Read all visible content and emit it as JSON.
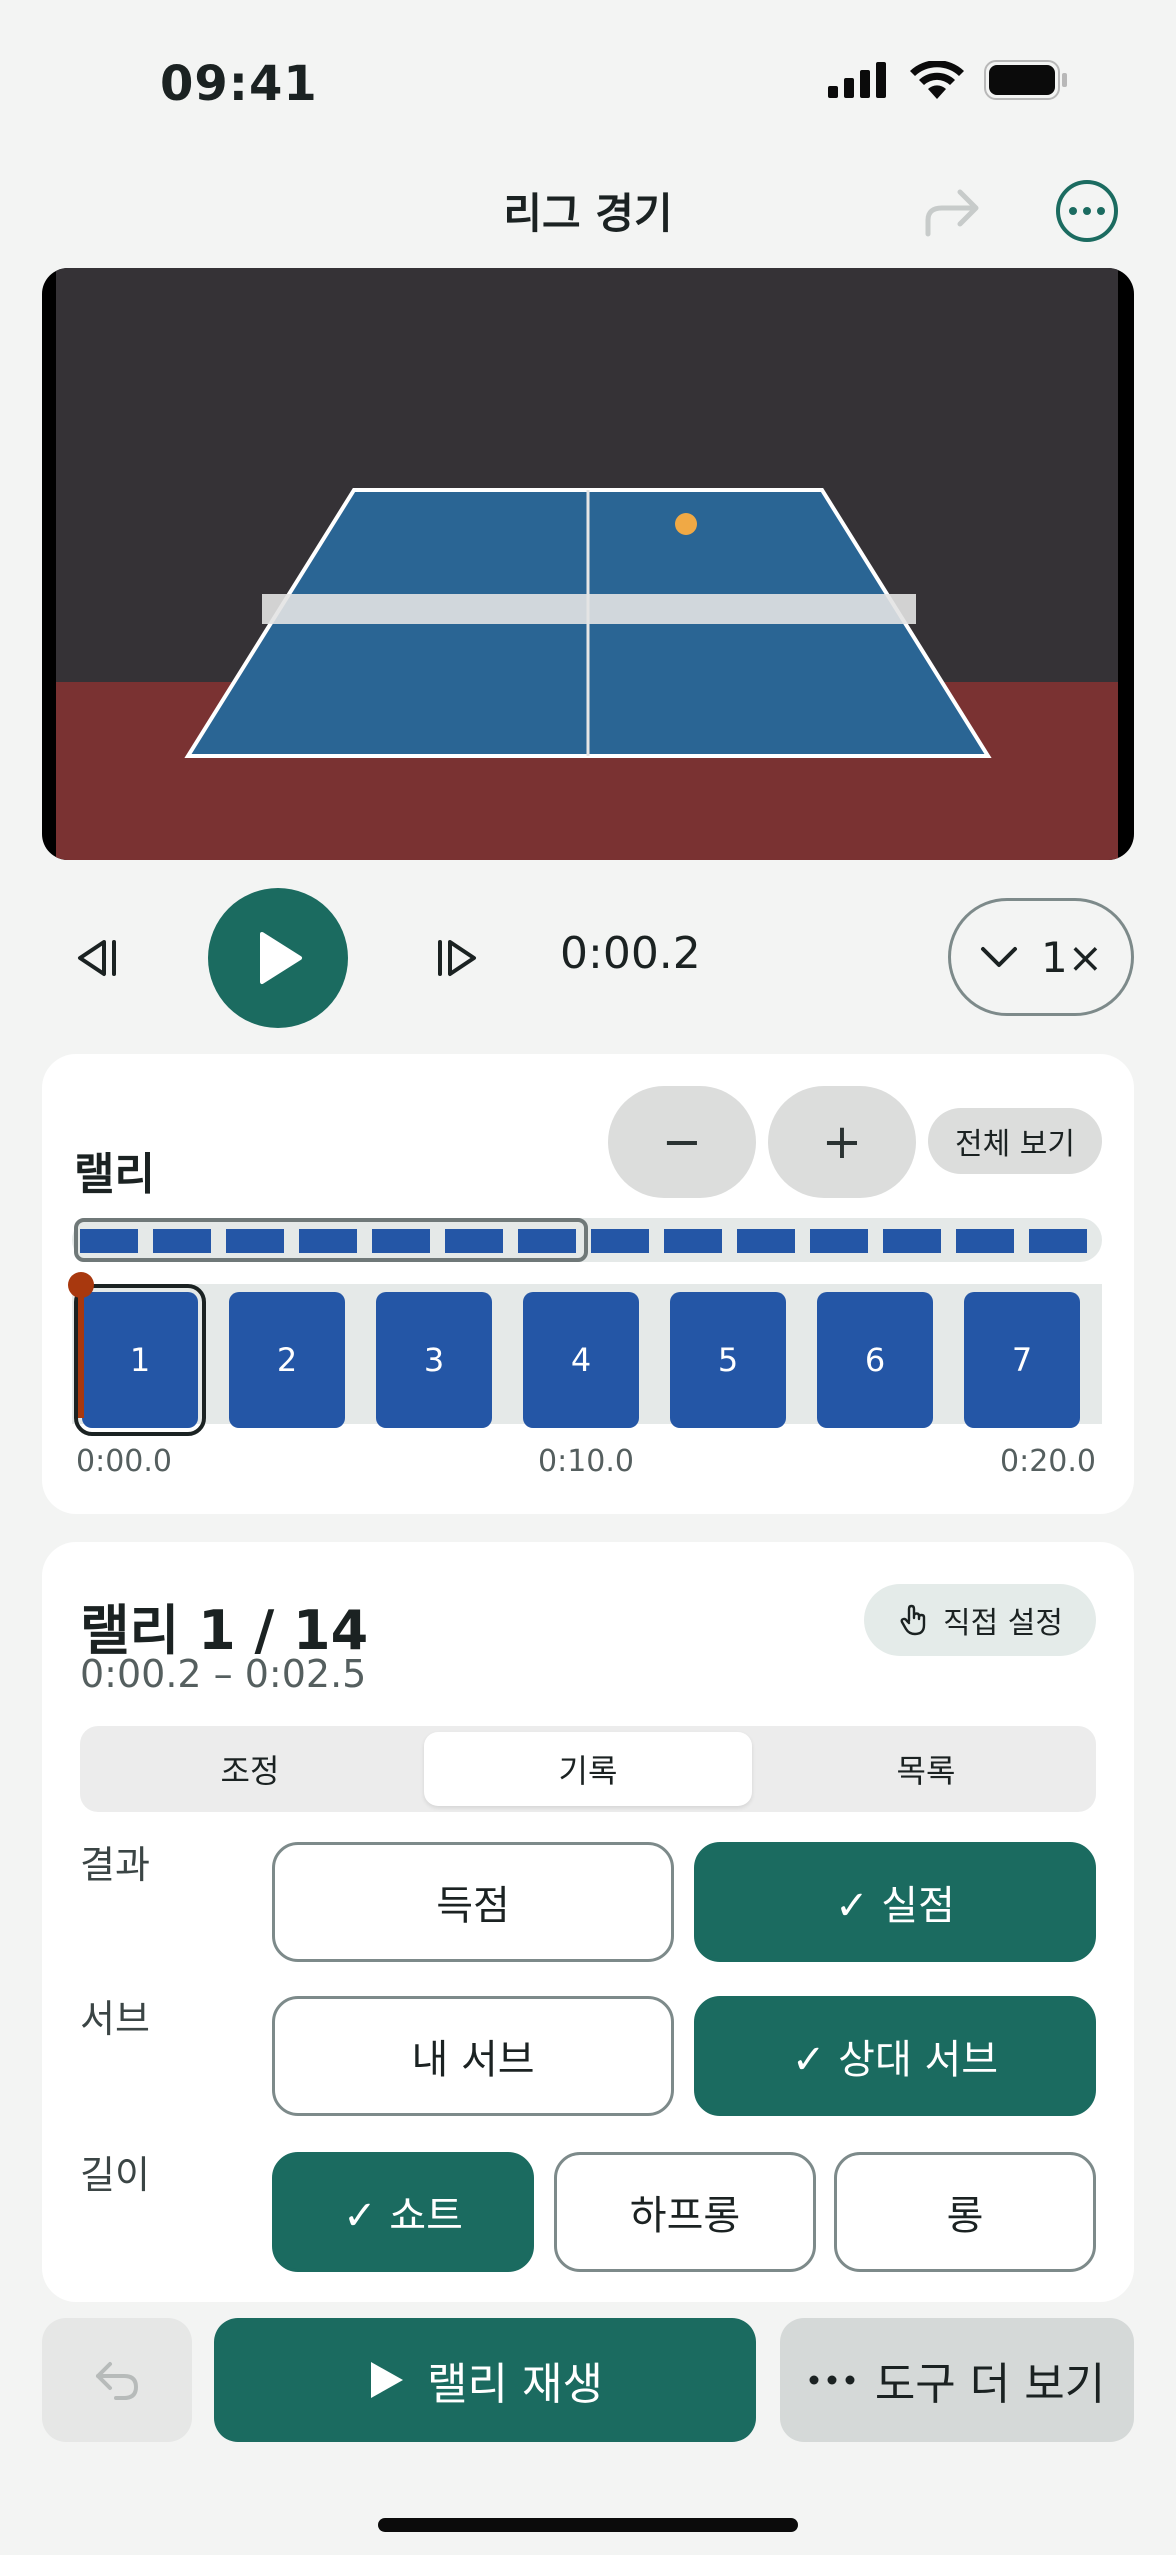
{
  "status": {
    "time": "09:41"
  },
  "nav": {
    "title": "리그 경기"
  },
  "player": {
    "current_time": "0:00.2",
    "speed": "1×"
  },
  "rally_timeline": {
    "label": "랠리",
    "zoom_out": "−",
    "zoom_in": "+",
    "view_all": "전체 보기",
    "total_rallies": 14,
    "visible_blocks": [
      "1",
      "2",
      "3",
      "4",
      "5",
      "6",
      "7"
    ],
    "selected_block": "1",
    "tick_labels": [
      "0:00.0",
      "0:10.0",
      "0:20.0"
    ],
    "playhead_time": "0:00.0"
  },
  "detail": {
    "title": "랠리 1 / 14",
    "range": "0:00.2 – 0:02.5",
    "manual_set": "직접 설정",
    "tabs": [
      {
        "label": "조정",
        "active": false
      },
      {
        "label": "기록",
        "active": true
      },
      {
        "label": "목록",
        "active": false
      }
    ],
    "rows": [
      {
        "label": "결과",
        "options": [
          {
            "label": "득점",
            "selected": false
          },
          {
            "label": "✓ 실점",
            "selected": true
          }
        ]
      },
      {
        "label": "서브",
        "options": [
          {
            "label": "내 서브",
            "selected": false
          },
          {
            "label": "✓ 상대 서브",
            "selected": true
          }
        ]
      },
      {
        "label": "길이",
        "options": [
          {
            "label": "✓ 쇼트",
            "selected": true
          },
          {
            "label": "하프롱",
            "selected": false
          },
          {
            "label": "롱",
            "selected": false
          }
        ]
      }
    ]
  },
  "bottom_bar": {
    "play_rally": "랠리 재생",
    "more_tools": "도구 더 보기"
  },
  "colors": {
    "accent": "#1b6b60",
    "rally_block": "#2456a6",
    "playhead": "#a8380e",
    "table": "#2a6594",
    "floor": "#7a3232",
    "wall": "#353236",
    "ball": "#f0a945"
  }
}
